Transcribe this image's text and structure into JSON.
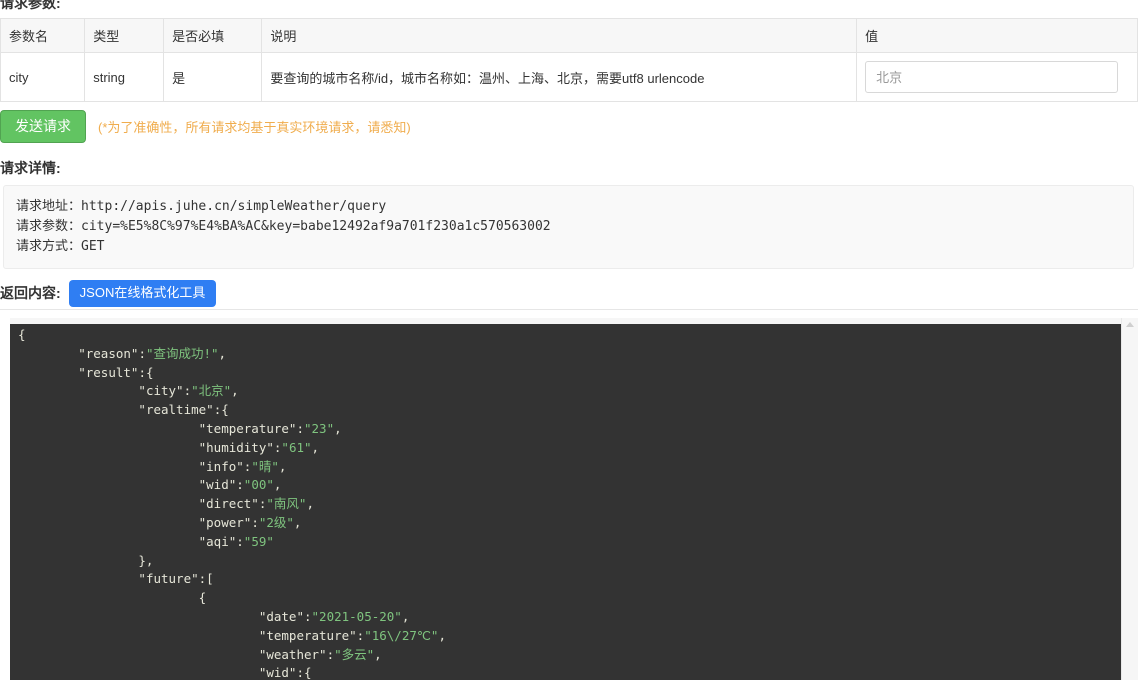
{
  "sections": {
    "params_title": "请求参数:",
    "detail_title": "请求详情:",
    "return_label": "返回内容:"
  },
  "params_table": {
    "headers": [
      "参数名",
      "类型",
      "是否必填",
      "说明",
      "值"
    ],
    "rows": [
      {
        "name": "city",
        "type": "string",
        "required": "是",
        "description": "要查询的城市名称/id，城市名称如：温州、上海、北京，需要utf8 urlencode",
        "value": "北京",
        "placeholder": "北京"
      }
    ]
  },
  "actions": {
    "send_button": "发送请求",
    "send_note": "(*为了准确性，所有请求均基于真实环境请求，请悉知)",
    "json_tool_button": "JSON在线格式化工具"
  },
  "request_detail": {
    "url_label": "请求地址：",
    "url_value": "http://apis.juhe.cn/simpleWeather/query",
    "params_label": "请求参数：",
    "params_value": "city=%E5%8C%97%E4%BA%AC&key=babe12492af9a701f230a1c570563002",
    "method_label": "请求方式：",
    "method_value": "GET"
  },
  "response": {
    "reason": "查询成功!",
    "result": {
      "city": "北京",
      "realtime": {
        "temperature": "23",
        "humidity": "61",
        "info": "晴",
        "wid": "00",
        "direct": "南风",
        "power": "2级",
        "aqi": "59"
      },
      "future": [
        {
          "date": "2021-05-20",
          "temperature": "16\\/27℃",
          "weather": "多云",
          "wid": "{"
        }
      ]
    },
    "raw_text": "{\n        \"reason\":\"查询成功!\",\n        \"result\":{\n                \"city\":\"北京\",\n                \"realtime\":{\n                        \"temperature\":\"23\",\n                        \"humidity\":\"61\",\n                        \"info\":\"晴\",\n                        \"wid\":\"00\",\n                        \"direct\":\"南风\",\n                        \"power\":\"2级\",\n                        \"aqi\":\"59\"\n                },\n                \"future\":[\n                        {\n                                \"date\":\"2021-05-20\",\n                                \"temperature\":\"16\\/27℃\",\n                                \"weather\":\"多云\",\n                                \"wid\":{"
  },
  "colors": {
    "send_button_bg": "#62c462",
    "send_note_text": "#f0ad4e",
    "json_tool_bg": "#2f7ef3",
    "code_bg": "#333333",
    "code_string": "#7fc47f",
    "code_key": "#e6e6d8"
  }
}
